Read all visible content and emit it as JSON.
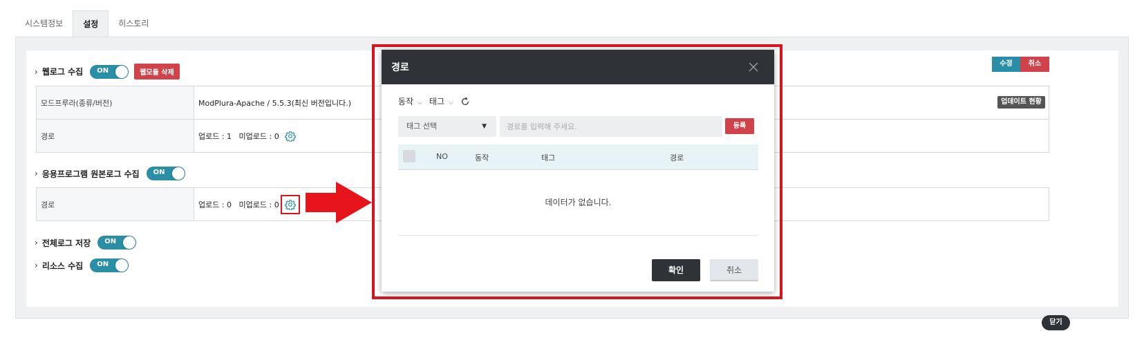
{
  "tabs": [
    {
      "label": "시스템정보"
    },
    {
      "label": "설정"
    },
    {
      "label": "히스토리"
    }
  ],
  "sections": {
    "weblog": {
      "title": "웹로그 수집",
      "toggle": "ON",
      "delete_label": "웹모듈 삭제"
    },
    "applog": {
      "title": "응용프로그램 원본로그 수집",
      "toggle": "ON"
    },
    "fulllog": {
      "title": "전체로그 저장",
      "toggle": "ON"
    },
    "resource": {
      "title": "리소스 수집",
      "toggle": "ON"
    }
  },
  "weblog_table": {
    "rows": [
      {
        "label": "모드프루라(종류/버전)",
        "value": "ModPlura-Apache / 5.5.3(최신 버전입니다.)"
      },
      {
        "label": "경로",
        "value": "업로드 : 1   미업로드 : 0"
      }
    ]
  },
  "applog_table": {
    "rows": [
      {
        "label": "경로",
        "value": "업로드 : 0   미업로드 : 0"
      }
    ]
  },
  "buttons": {
    "edit": "수정",
    "cancel": "취소",
    "update_status": "업데이트 현황",
    "close": "닫기"
  },
  "modal": {
    "title": "경로",
    "filters": [
      {
        "label": "동작"
      },
      {
        "label": "태그"
      }
    ],
    "tag_select": "태그 선택",
    "path_placeholder": "경로를 입력해 주세요.",
    "register": "등록",
    "columns": [
      "NO",
      "동작",
      "태그",
      "경로"
    ],
    "empty": "데이터가 없습니다.",
    "ok": "확인",
    "cancel": "취소"
  },
  "colors": {
    "accent": "#2a8ea6",
    "danger": "#d0434a",
    "modal_header": "#2f3237",
    "highlight": "#d9141c"
  }
}
